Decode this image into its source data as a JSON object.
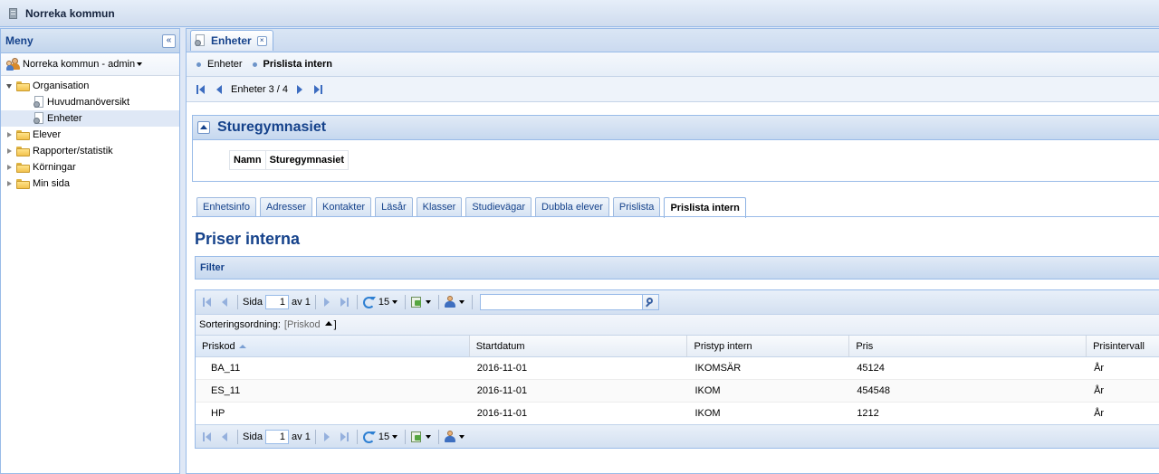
{
  "app": {
    "title": "Norreka kommun"
  },
  "sidebar": {
    "title": "Meny",
    "user": "Norreka kommun - admin",
    "tree": [
      {
        "label": "Organisation"
      },
      {
        "label": "Huvudmanöversikt"
      },
      {
        "label": "Enheter"
      },
      {
        "label": "Elever"
      },
      {
        "label": "Rapporter/statistik"
      },
      {
        "label": "Körningar"
      },
      {
        "label": "Min sida"
      }
    ]
  },
  "main_tab": {
    "label": "Enheter"
  },
  "breadcrumb": [
    "Enheter",
    "Prislista intern"
  ],
  "pager": {
    "label": "Enheter 3 / 4"
  },
  "unit": {
    "title": "Sturegymnasiet",
    "field_label": "Namn",
    "field_value": "Sturegymnasiet"
  },
  "tabs": [
    "Enhetsinfo",
    "Adresser",
    "Kontakter",
    "Läsår",
    "Klasser",
    "Studievägar",
    "Dubbla elever",
    "Prislista",
    "Prislista intern"
  ],
  "section": {
    "title": "Priser interna",
    "filter_label": "Filter"
  },
  "grid_toolbar": {
    "page_label": "Sida",
    "page_value": "1",
    "of_label": "av 1",
    "page_size": "15",
    "search_value": ""
  },
  "sort": {
    "label": "Sorteringsordning:",
    "field": "[Priskod",
    "close": "]"
  },
  "grid": {
    "columns": [
      "Priskod",
      "Startdatum",
      "Pristyp intern",
      "Pris",
      "Prisintervall"
    ],
    "rows": [
      [
        "BA_11",
        "2016-11-01",
        "IKOMSÄR",
        "45124",
        "År"
      ],
      [
        "ES_11",
        "2016-11-01",
        "IKOM",
        "454548",
        "År"
      ],
      [
        "HP",
        "2016-11-01",
        "IKOM",
        "1212",
        "År"
      ]
    ]
  }
}
